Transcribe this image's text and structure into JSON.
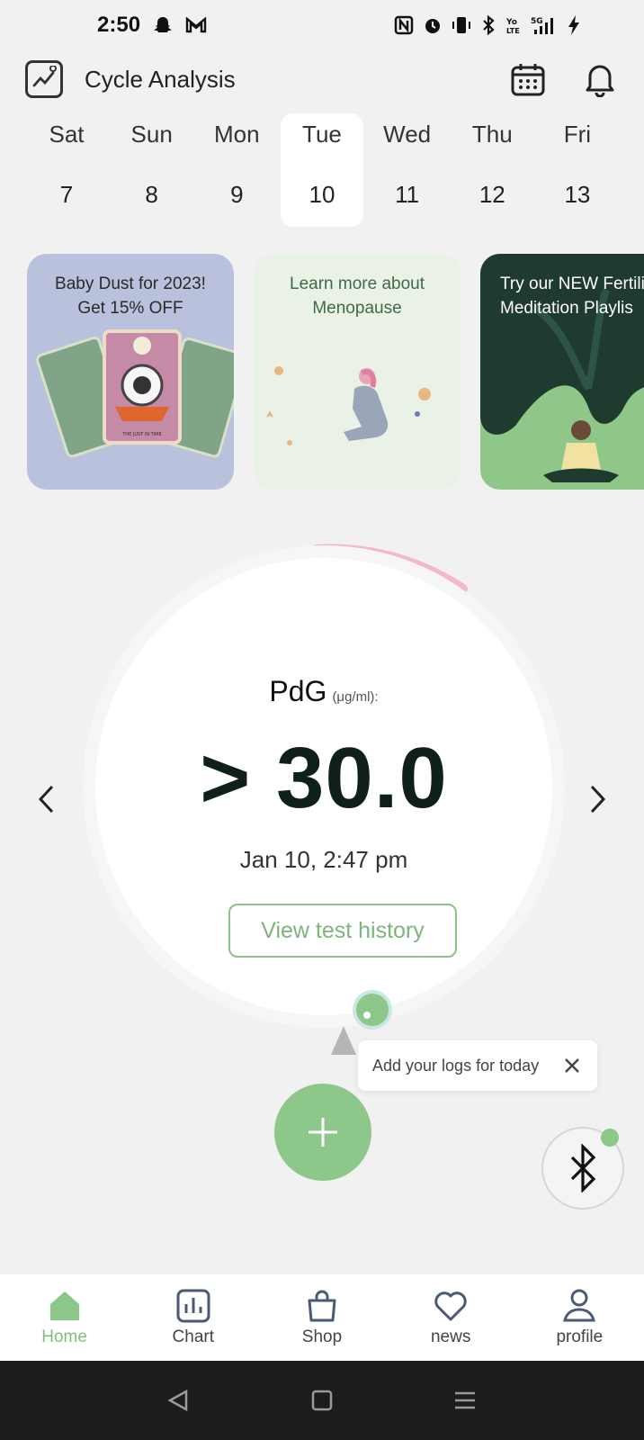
{
  "status_bar": {
    "time": "2:50",
    "icons_left": [
      "snapchat-icon",
      "gmail-icon"
    ],
    "icons_right": [
      "nfc-icon",
      "alarm-icon",
      "vibrate-icon",
      "bluetooth-icon",
      "volte-icon",
      "5g-signal-icon",
      "battery-charging-icon"
    ]
  },
  "header": {
    "title": "Cycle Analysis",
    "icons": [
      "chart-logo-icon",
      "calendar-icon",
      "bell-icon"
    ]
  },
  "week": {
    "days": [
      {
        "name": "Sat",
        "num": "7",
        "selected": false
      },
      {
        "name": "Sun",
        "num": "8",
        "selected": false
      },
      {
        "name": "Mon",
        "num": "9",
        "selected": false
      },
      {
        "name": "Tue",
        "num": "10",
        "selected": true
      },
      {
        "name": "Wed",
        "num": "11",
        "selected": false
      },
      {
        "name": "Thu",
        "num": "12",
        "selected": false
      },
      {
        "name": "Fri",
        "num": "13",
        "selected": false
      }
    ]
  },
  "promos": [
    {
      "title": "Baby Dust for 2023! Get 15% OFF",
      "line1": "Baby Dust for 2023!",
      "line2": "Get 15% OFF",
      "card_caption": "THE JUST IN TIME"
    },
    {
      "title": "Learn more about Menopause",
      "line1": "Learn more about",
      "line2": "Menopause"
    },
    {
      "title": "Try our NEW Fertility Meditation Playlist",
      "line1": "Try our NEW Fertili",
      "line2": "Meditation Playlis"
    }
  ],
  "gauge": {
    "label": "PdG",
    "unit": "(μg/ml):",
    "value": "> 30.0",
    "timestamp": "Jan 10, 2:47 pm",
    "history_button": "View test history",
    "colors": {
      "follicular_arc": "#f3b8cc",
      "luteal_arc": "#c8e8e6",
      "marker": "#8dc78a"
    }
  },
  "tooltip": {
    "text": "Add your logs for today"
  },
  "bottom_nav": {
    "items": [
      {
        "label": "Home",
        "icon": "home-icon",
        "active": true
      },
      {
        "label": "Chart",
        "icon": "bar-chart-icon",
        "active": false
      },
      {
        "label": "Shop",
        "icon": "shopping-bag-icon",
        "active": false
      },
      {
        "label": "news",
        "icon": "heart-icon",
        "active": false
      },
      {
        "label": "profile",
        "icon": "user-icon",
        "active": false
      }
    ]
  },
  "colors": {
    "accent_green": "#8dc78a",
    "background": "#f2f1f2"
  }
}
